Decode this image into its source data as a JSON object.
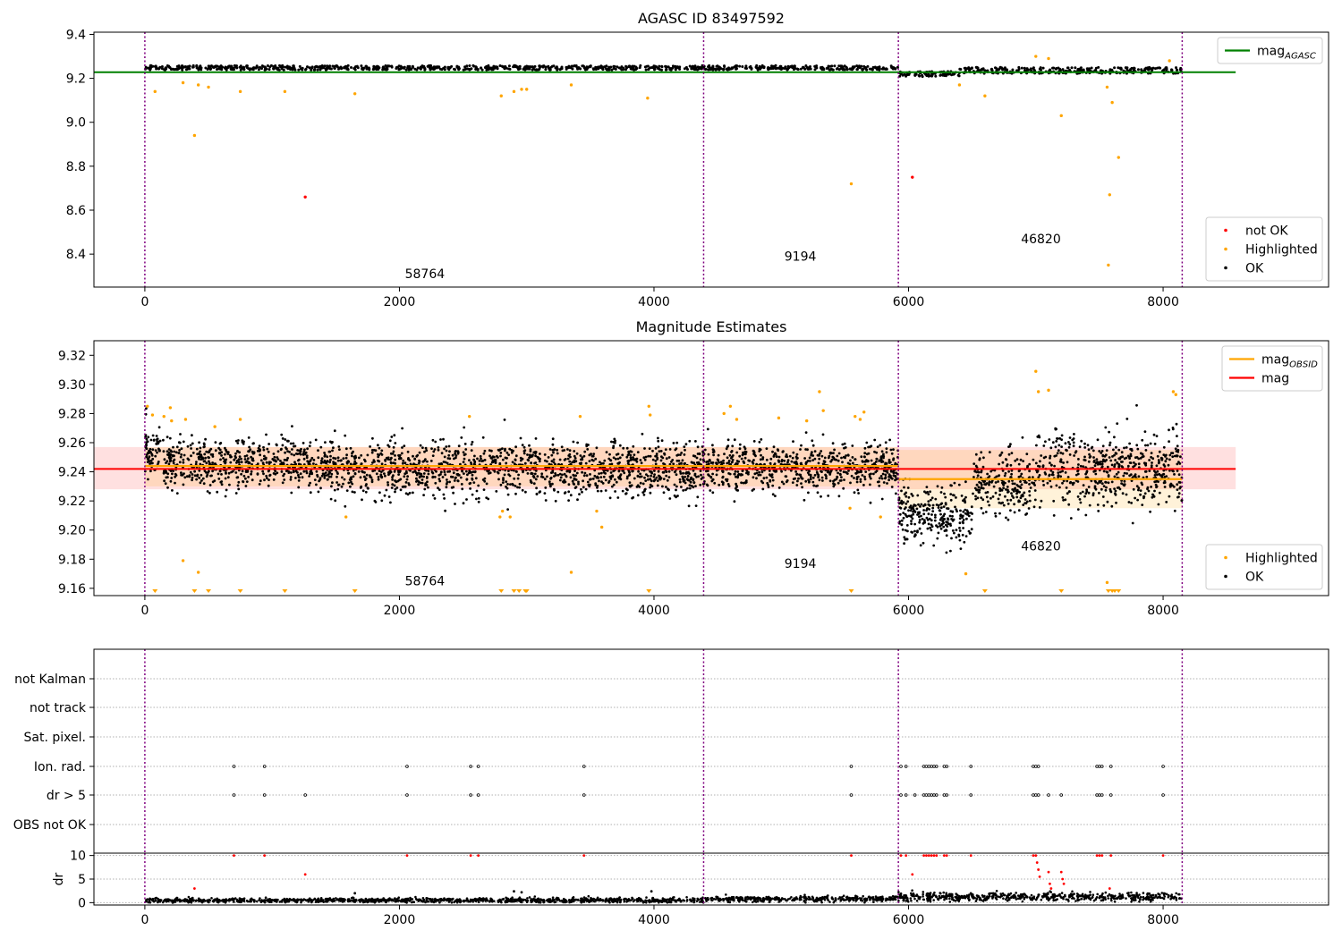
{
  "chart_data": [
    {
      "id": "agasc",
      "type": "scatter",
      "title": "AGASC ID 83497592",
      "xlim": [
        -400,
        9300
      ],
      "ylim": [
        8.25,
        9.41
      ],
      "xticks": [
        0,
        2000,
        4000,
        6000,
        8000
      ],
      "yticks": [
        8.4,
        8.6,
        8.8,
        9.0,
        9.2,
        9.4
      ],
      "ytick_decimals": 1,
      "vlines": [
        0,
        4390,
        5920,
        8150
      ],
      "obsid_labels": [
        {
          "text": "58764",
          "x": 2200,
          "y": 8.29
        },
        {
          "text": "9194",
          "x": 5150,
          "y": 8.37
        },
        {
          "text": "46820",
          "x": 7040,
          "y": 8.45
        }
      ],
      "reference_lines": [
        {
          "name": "mag",
          "subscript": "AGASC",
          "color": "#008000",
          "y": 9.228,
          "x0": -400,
          "x1": 8570
        }
      ],
      "ok_band": {
        "segments": [
          {
            "x0": 0,
            "x1": 5920,
            "y0": 9.238,
            "y1": 9.258
          },
          {
            "x0": 5920,
            "x1": 6400,
            "y0": 9.208,
            "y1": 9.232
          },
          {
            "x0": 6400,
            "x1": 8150,
            "y0": 9.222,
            "y1": 9.25
          }
        ],
        "color": "#000000"
      },
      "series": [
        {
          "name": "not OK",
          "color": "#ff0000",
          "x": [
            1260,
            6030
          ],
          "y": [
            8.66,
            8.75
          ]
        },
        {
          "name": "Highlighted",
          "color": "#ffa500",
          "x": [
            80,
            300,
            390,
            420,
            500,
            750,
            1100,
            1650,
            2800,
            2900,
            2960,
            3000,
            3350,
            3950,
            5550,
            6400,
            6600,
            7200,
            7560,
            7570,
            7600,
            7650,
            7580,
            7000,
            7100,
            8050
          ],
          "y": [
            9.14,
            9.18,
            8.94,
            9.17,
            9.16,
            9.14,
            9.14,
            9.13,
            9.12,
            9.14,
            9.15,
            9.15,
            9.17,
            9.11,
            8.72,
            9.17,
            9.12,
            9.03,
            9.16,
            8.35,
            9.09,
            8.84,
            8.67,
            9.3,
            9.29,
            9.28
          ]
        },
        {
          "name": "OK",
          "color": "#000000",
          "x": [],
          "y": []
        }
      ],
      "legends": [
        {
          "position": "top-right",
          "entries": [
            {
              "name": "mag",
              "subscript": "AGASC",
              "kind": "line",
              "color": "#008000"
            }
          ]
        },
        {
          "position": "bottom-right",
          "entries": [
            {
              "name": "not OK",
              "kind": "marker",
              "color": "#ff0000"
            },
            {
              "name": "Highlighted",
              "kind": "marker",
              "color": "#ffa500"
            },
            {
              "name": "OK",
              "kind": "marker",
              "color": "#000000"
            }
          ]
        }
      ]
    },
    {
      "id": "estimates",
      "type": "scatter",
      "title": "Magnitude Estimates",
      "xlim": [
        -400,
        9300
      ],
      "ylim": [
        9.155,
        9.33
      ],
      "xticks": [
        0,
        2000,
        4000,
        6000,
        8000
      ],
      "yticks": [
        9.16,
        9.18,
        9.2,
        9.22,
        9.24,
        9.26,
        9.28,
        9.3,
        9.32
      ],
      "ytick_decimals": 2,
      "vlines": [
        0,
        4390,
        5920,
        8150
      ],
      "obsid_labels": [
        {
          "text": "58764",
          "x": 2200,
          "y": 9.162
        },
        {
          "text": "9194",
          "x": 5150,
          "y": 9.174
        },
        {
          "text": "46820",
          "x": 7040,
          "y": 9.186
        }
      ],
      "reference_lines": [
        {
          "name": "mag",
          "color": "#ff0000",
          "y": 9.242,
          "x0": -400,
          "x1": 8570,
          "band": [
            9.228,
            9.257
          ]
        }
      ],
      "obsid_mags": [
        {
          "x0": 0,
          "x1": 5920,
          "y": 9.244,
          "band": [
            9.23,
            9.257
          ]
        },
        {
          "x0": 5920,
          "x1": 8150,
          "y": 9.235,
          "band": [
            9.215,
            9.255
          ]
        }
      ],
      "ok_scatter": {
        "segments": [
          {
            "x0": 0,
            "x1": 150,
            "mean": 9.255,
            "sd": 0.008
          },
          {
            "x0": 150,
            "x1": 1300,
            "mean": 9.246,
            "sd": 0.009
          },
          {
            "x0": 1300,
            "x1": 4390,
            "mean": 9.242,
            "sd": 0.009
          },
          {
            "x0": 4390,
            "x1": 5920,
            "mean": 9.243,
            "sd": 0.008
          },
          {
            "x0": 5920,
            "x1": 6500,
            "mean": 9.21,
            "sd": 0.01
          },
          {
            "x0": 6500,
            "x1": 7000,
            "mean": 9.232,
            "sd": 0.011
          },
          {
            "x0": 7000,
            "x1": 8150,
            "mean": 9.242,
            "sd": 0.012
          }
        ],
        "color": "#000000"
      },
      "series": [
        {
          "name": "Highlighted",
          "color": "#ffa500",
          "x": [
            20,
            60,
            150,
            200,
            210,
            300,
            320,
            420,
            550,
            750,
            1580,
            2550,
            2790,
            2810,
            2870,
            3350,
            3420,
            3550,
            3590,
            3960,
            3970,
            4550,
            4600,
            4650,
            4980,
            5200,
            5300,
            5330,
            5540,
            5580,
            5620,
            5650,
            5780,
            6450,
            7000,
            7020,
            7100,
            7560,
            8080,
            8100
          ],
          "y": [
            9.285,
            9.279,
            9.278,
            9.284,
            9.275,
            9.179,
            9.276,
            9.171,
            9.271,
            9.276,
            9.209,
            9.278,
            9.209,
            9.213,
            9.209,
            9.171,
            9.278,
            9.213,
            9.202,
            9.285,
            9.279,
            9.28,
            9.285,
            9.276,
            9.277,
            9.275,
            9.295,
            9.282,
            9.215,
            9.278,
            9.276,
            9.281,
            9.209,
            9.17,
            9.309,
            9.295,
            9.296,
            9.164,
            9.295,
            9.293
          ]
        },
        {
          "name": "OK",
          "color": "#000000",
          "x": [],
          "y": []
        }
      ],
      "clipped_markers": {
        "color": "#ffa500",
        "x": [
          80,
          390,
          500,
          750,
          1100,
          1650,
          2800,
          2900,
          2940,
          2990,
          3000,
          3960,
          5550,
          6600,
          7200,
          7570,
          7600,
          7620,
          7650
        ]
      },
      "legends": [
        {
          "position": "top-right",
          "entries": [
            {
              "name": "mag",
              "subscript": "OBSID",
              "kind": "line",
              "color": "#ffa500"
            },
            {
              "name": "mag",
              "kind": "line",
              "color": "#ff0000"
            }
          ]
        },
        {
          "position": "bottom-right",
          "entries": [
            {
              "name": "Highlighted",
              "kind": "marker",
              "color": "#ffa500"
            },
            {
              "name": "OK",
              "kind": "marker",
              "color": "#000000"
            }
          ]
        }
      ]
    },
    {
      "id": "flags",
      "type": "scatter",
      "xlim": [
        -400,
        9300
      ],
      "rows": [
        "not Kalman",
        "not track",
        "Sat. pixel.",
        "Ion. rad.",
        "dr > 5",
        "OBS not OK"
      ],
      "vlines": [
        0,
        4390,
        5920,
        8150
      ],
      "flag_points": {
        "Ion. rad.": [
          700,
          940,
          2060,
          2560,
          2620,
          3450,
          5550,
          5940,
          5980,
          6120,
          6140,
          6160,
          6180,
          6200,
          6220,
          6280,
          6300,
          6490,
          6980,
          7000,
          7020,
          7480,
          7500,
          7520,
          7590,
          8000
        ],
        "dr > 5": [
          700,
          940,
          1260,
          2060,
          2560,
          2620,
          3450,
          5550,
          5940,
          5980,
          6050,
          6120,
          6140,
          6160,
          6180,
          6200,
          6220,
          6280,
          6300,
          6490,
          6980,
          7000,
          7020,
          7100,
          7200,
          7480,
          7500,
          7520,
          7590,
          8000
        ]
      }
    },
    {
      "id": "dr",
      "type": "scatter",
      "ylabel": "dr",
      "xlim": [
        -400,
        9300
      ],
      "ylim": [
        -0.5,
        10.5
      ],
      "xticks": [
        0,
        2000,
        4000,
        6000,
        8000
      ],
      "yticks": [
        0,
        5,
        10
      ],
      "vlines": [
        0,
        4390,
        5920,
        8150
      ],
      "baseline": {
        "segments": [
          {
            "x0": 0,
            "x1": 4390,
            "mean": 0.5,
            "sd": 0.25
          },
          {
            "x0": 4390,
            "x1": 5920,
            "mean": 0.8,
            "sd": 0.3
          },
          {
            "x0": 5920,
            "x1": 8150,
            "mean": 1.2,
            "sd": 0.45
          }
        ],
        "color": "#000000"
      },
      "series": [
        {
          "name": "dr > 5",
          "color": "#ff0000",
          "x": [
            700,
            940,
            1260,
            390,
            2060,
            2560,
            2620,
            3450,
            5550,
            5940,
            5980,
            6030,
            6120,
            6140,
            6160,
            6180,
            6200,
            6220,
            6280,
            6300,
            6490,
            6980,
            7000,
            7010,
            7020,
            7030,
            7100,
            7110,
            7120,
            7200,
            7210,
            7220,
            7480,
            7500,
            7520,
            7590,
            7580,
            8000
          ],
          "y": [
            10,
            10,
            6,
            3,
            10,
            10,
            10,
            10,
            10,
            10,
            10,
            6,
            10,
            10,
            10,
            10,
            10,
            10,
            10,
            10,
            10,
            10,
            10,
            8.5,
            7,
            5.5,
            6.5,
            4,
            3,
            6.5,
            5,
            4,
            10,
            10,
            10,
            10,
            3,
            10
          ]
        },
        {
          "name": "dr",
          "color": "#000000",
          "x": [
            1650,
            2900,
            2960,
            3980
          ],
          "y": [
            2,
            2.4,
            2.2,
            2.4
          ]
        }
      ]
    }
  ]
}
